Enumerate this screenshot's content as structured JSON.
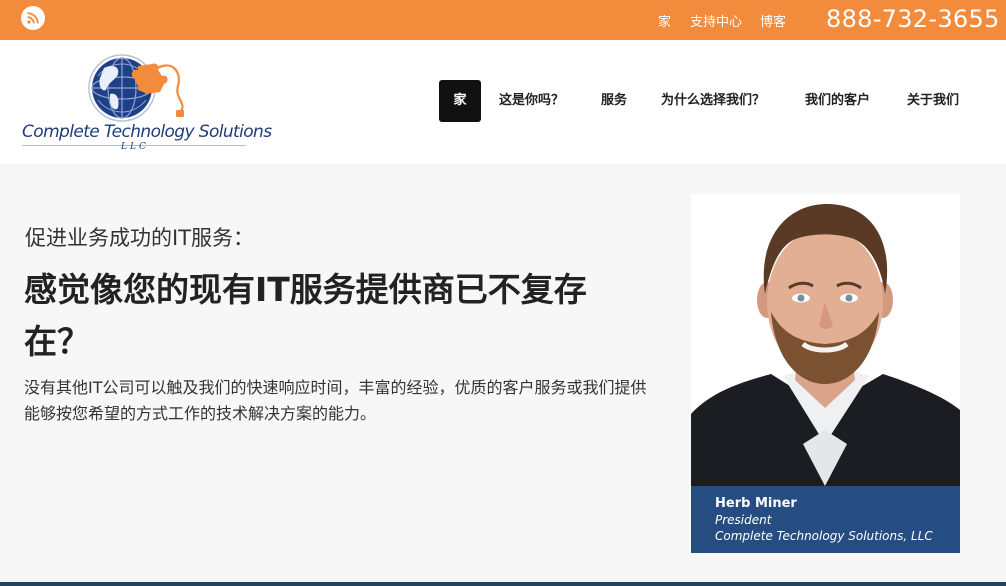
{
  "topbar": {
    "links": [
      "家",
      "支持中心",
      "博客"
    ],
    "phone": "888-732-3655",
    "colors": {
      "bar": "#f28b3c"
    }
  },
  "logo": {
    "name": "Complete Technology Solutions",
    "suffix": "LLC"
  },
  "nav": {
    "items": [
      "家",
      "这是你吗？",
      "服务",
      "为什么选择我们？",
      "我们的客户",
      "关于我们"
    ],
    "active_index": 0
  },
  "hero": {
    "subtitle": "促进业务成功的IT服务：",
    "title": "感觉像您的现有IT服务提供商已不复存在？",
    "body": "没有其他IT公司可以触及我们的快速响应时间，丰富的经验，优质的客户服务或我们提供能够按您希望的方式工作的技术解决方案的能力。"
  },
  "profile": {
    "name": "Herb Miner",
    "role": "President",
    "company": "Complete Technology Solutions, LLC",
    "colors": {
      "caption": "#264d82"
    }
  },
  "icons": {
    "rss": "rss-icon",
    "globe": "globe-icon"
  }
}
